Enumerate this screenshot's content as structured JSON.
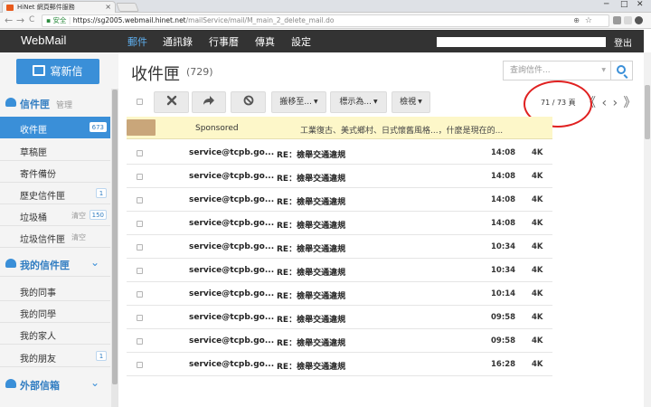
{
  "browser": {
    "tab_title": "HiNet 網頁郵件服務",
    "tab_close": "×",
    "window_controls": [
      "─",
      "□",
      "✕"
    ],
    "nav": {
      "back": "←",
      "forward": "→",
      "reload": "C"
    },
    "url_secure": "安全",
    "url_host": "https://sg2005.webmail.hinet.net",
    "url_path": "/mailService/mail/M_main_2_delete_mail.do",
    "star_icon": "☆",
    "zoom_icon": "⊕"
  },
  "topbar": {
    "brand": "WebMail",
    "nav": [
      "郵件",
      "通訊錄",
      "行事曆",
      "傳真",
      "設定"
    ],
    "active_nav": 0,
    "logout": "登出"
  },
  "sidebar": {
    "compose_label": "寫新信",
    "sections": [
      {
        "title": "信件匣",
        "manage": "管理",
        "icon": "cloud-icon",
        "items": [
          {
            "label": "收件匣",
            "count": "673",
            "active": true
          },
          {
            "label": "草稿匣"
          },
          {
            "label": "寄件備份"
          },
          {
            "label": "歷史信件匣",
            "count": "1"
          },
          {
            "label": "垃圾桶",
            "extra": "清空",
            "count": "150"
          },
          {
            "label": "垃圾信件匣",
            "extra": "清空"
          }
        ]
      },
      {
        "title": "我的信件匣",
        "icon": "user-folder-icon",
        "chevron": "⌄",
        "items": [
          {
            "label": "我的同事"
          },
          {
            "label": "我的同學"
          },
          {
            "label": "我的家人"
          },
          {
            "label": "我的朋友",
            "count": "1"
          }
        ]
      },
      {
        "title": "外部信箱",
        "icon": "globe-icon",
        "chevron": "⌄"
      }
    ]
  },
  "main": {
    "title": "收件匣",
    "count": "(729)",
    "search_placeholder": "查詢信件...",
    "toolbar": {
      "move_label": "搬移至...",
      "mark_label": "標示為...",
      "view_label": "檢視"
    },
    "pager": "71 / 73 頁",
    "pager_arrows": "《 ‹ › 》"
  },
  "sponsored": {
    "label": "Sponsored",
    "description": "工業復古、美式鄉村、日式懷舊風格...，什麼是現在的..."
  },
  "mails": [
    {
      "sender": "service@tcpb.go...",
      "subject": "RE：檢舉交通違規",
      "time": "14:08",
      "size": "4K"
    },
    {
      "sender": "service@tcpb.go...",
      "subject": "RE：檢舉交通違規",
      "time": "14:08",
      "size": "4K"
    },
    {
      "sender": "service@tcpb.go...",
      "subject": "RE：檢舉交通違規",
      "time": "14:08",
      "size": "4K"
    },
    {
      "sender": "service@tcpb.go...",
      "subject": "RE：檢舉交通違規",
      "time": "14:08",
      "size": "4K"
    },
    {
      "sender": "service@tcpb.go...",
      "subject": "RE：檢舉交通違規",
      "time": "10:34",
      "size": "4K"
    },
    {
      "sender": "service@tcpb.go...",
      "subject": "RE：檢舉交通違規",
      "time": "10:34",
      "size": "4K"
    },
    {
      "sender": "service@tcpb.go...",
      "subject": "RE：檢舉交通違規",
      "time": "10:14",
      "size": "4K"
    },
    {
      "sender": "service@tcpb.go...",
      "subject": "RE：檢舉交通違規",
      "time": "09:58",
      "size": "4K"
    },
    {
      "sender": "service@tcpb.go...",
      "subject": "RE：檢舉交通違規",
      "time": "09:58",
      "size": "4K"
    },
    {
      "sender": "service@tcpb.go...",
      "subject": "RE：檢舉交通違規",
      "time": "16:28",
      "size": "4K"
    }
  ],
  "colors": {
    "accent": "#3a8fd8",
    "topbar": "#333333",
    "sponsored_bg": "#fdf7c9",
    "annotation": "#e02020"
  }
}
